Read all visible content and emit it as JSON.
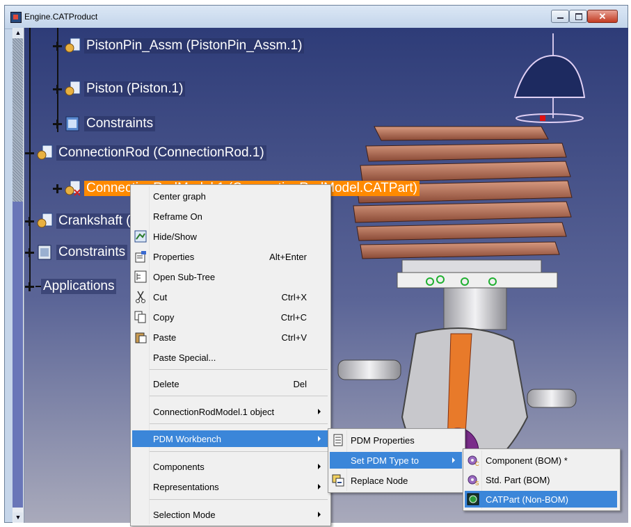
{
  "window": {
    "title": "Engine.CATProduct",
    "close_glyph": "✕"
  },
  "scrollbar": {
    "up_glyph": "▲",
    "down_glyph": "▼"
  },
  "tree": {
    "items": [
      {
        "label": "PistonPin_Assm (PistonPin_Assm.1)",
        "icon": "product-gear-icon"
      },
      {
        "label": "Piston (Piston.1)",
        "icon": "product-gear-icon"
      },
      {
        "label": "Constraints",
        "icon": "constraints-icon"
      },
      {
        "label": "ConnectionRod (ConnectionRod.1)",
        "icon": "product-gear-icon"
      },
      {
        "label": "ConnectionRodModel.1 (ConnectionRodModel.CATPart)",
        "icon": "part-gear-icon"
      },
      {
        "label": "Crankshaft (Crankshaft.1)",
        "icon": "product-gear-icon"
      },
      {
        "label": "Constraints",
        "icon": "constraints-icon"
      },
      {
        "label": "Applications",
        "icon": ""
      }
    ]
  },
  "context_menu": {
    "center_graph": "Center graph",
    "reframe_on": "Reframe On",
    "hide_show": "Hide/Show",
    "properties": "Properties",
    "properties_shortcut": "Alt+Enter",
    "open_sub_tree": "Open Sub-Tree",
    "cut": "Cut",
    "cut_shortcut": "Ctrl+X",
    "copy": "Copy",
    "copy_shortcut": "Ctrl+C",
    "paste": "Paste",
    "paste_shortcut": "Ctrl+V",
    "paste_special": "Paste Special...",
    "delete": "Delete",
    "delete_shortcut": "Del",
    "object": "ConnectionRodModel.1 object",
    "pdm_workbench": "PDM Workbench",
    "components": "Components",
    "representations": "Representations",
    "selection_mode": "Selection Mode"
  },
  "pdm_menu": {
    "pdm_properties": "PDM Properties",
    "set_pdm_type": "Set PDM Type to",
    "replace_node": "Replace Node"
  },
  "pdm_type_menu": {
    "component_bom": "Component (BOM) *",
    "std_part_bom": "Std. Part (BOM)",
    "catpart_non_bom": "CATPart (Non-BOM)"
  },
  "colors": {
    "selection_orange": "#ff8a00",
    "menu_highlight": "#3b86d9",
    "viewport_top": "#2e3c78"
  }
}
